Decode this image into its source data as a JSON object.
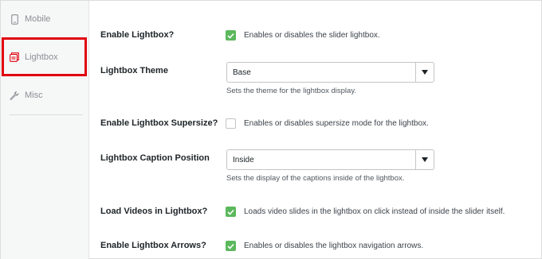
{
  "sidebar": {
    "items": [
      {
        "label": "Mobile",
        "icon": "mobile-icon"
      },
      {
        "label": "Lightbox",
        "icon": "lightbox-icon"
      },
      {
        "label": "Misc",
        "icon": "wrench-icon"
      }
    ],
    "active_index": 1,
    "highlight_color": "#e1000f"
  },
  "settings": {
    "enable_lightbox": {
      "label": "Enable Lightbox?",
      "checked": true,
      "description": "Enables or disables the slider lightbox."
    },
    "lightbox_theme": {
      "label": "Lightbox Theme",
      "value": "Base",
      "description": "Sets the theme for the lightbox display."
    },
    "enable_supersize": {
      "label": "Enable Lightbox Supersize?",
      "checked": false,
      "description": "Enables or disables supersize mode for the lightbox."
    },
    "caption_position": {
      "label": "Lightbox Caption Position",
      "value": "Inside",
      "description": "Sets the display of the captions inside of the lightbox."
    },
    "load_videos": {
      "label": "Load Videos in Lightbox?",
      "checked": true,
      "description": "Loads video slides in the lightbox on click instead of inside the slider itself."
    },
    "enable_arrows": {
      "label": "Enable Lightbox Arrows?",
      "checked": true,
      "description": "Enables or disables the lightbox navigation arrows."
    }
  },
  "colors": {
    "checkbox_checked": "#5cb85c"
  }
}
